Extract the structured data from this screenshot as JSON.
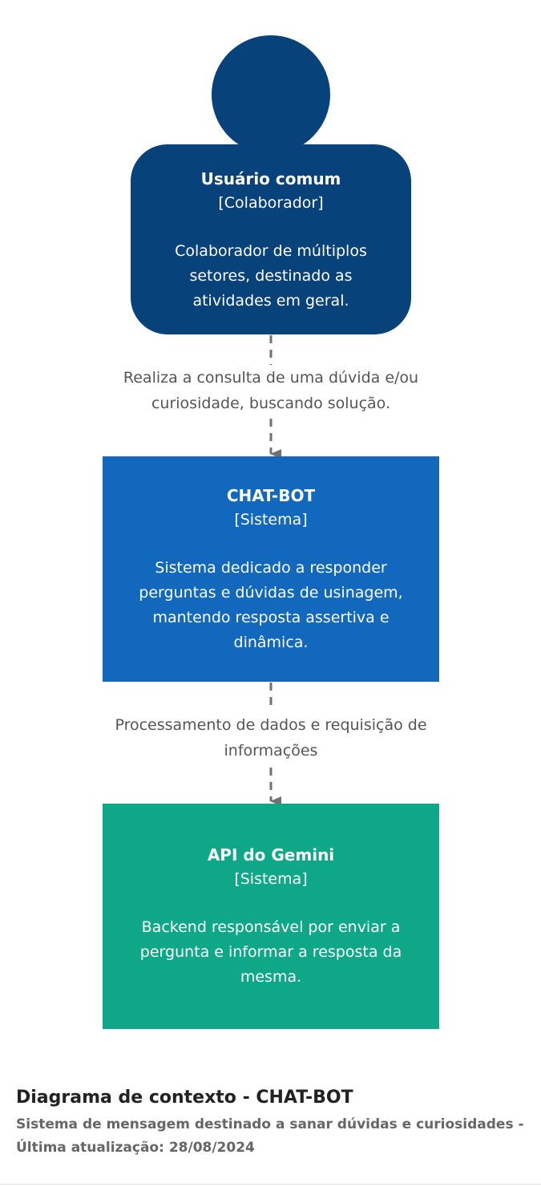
{
  "diagram": {
    "elements": {
      "user": {
        "name": "Usuário comum",
        "type": "[Colaborador]",
        "description": "Colaborador de múltiplos setores, destinado as atividades em geral.",
        "color": "#08427b"
      },
      "chatbot": {
        "name": "CHAT-BOT",
        "type": "[Sistema]",
        "description": "Sistema dedicado a responder perguntas e dúvidas de usinagem, mantendo resposta assertiva e dinâmica.",
        "color": "#1168bd"
      },
      "api": {
        "name": "API do Gemini",
        "type": "[Sistema]",
        "description": "Backend responsável por enviar a pergunta e informar a resposta da mesma.",
        "color": "#0ea888"
      }
    },
    "relationships": [
      {
        "from": "Usuário comum",
        "to": "CHAT-BOT",
        "label": "Realiza a consulta de uma dúvida e/ou curiosidade, buscando solução."
      },
      {
        "from": "CHAT-BOT",
        "to": "API do Gemini",
        "label": "Processamento de dados e requisição de informações"
      }
    ]
  },
  "footer": {
    "title": "Diagrama de contexto - CHAT-BOT",
    "subtitle": "Sistema de mensagem destinado a sanar dúvidas e curiosidades - Última atualização: 28/08/2024"
  },
  "colors": {
    "connector": "#707070",
    "label_text": "#555555"
  }
}
